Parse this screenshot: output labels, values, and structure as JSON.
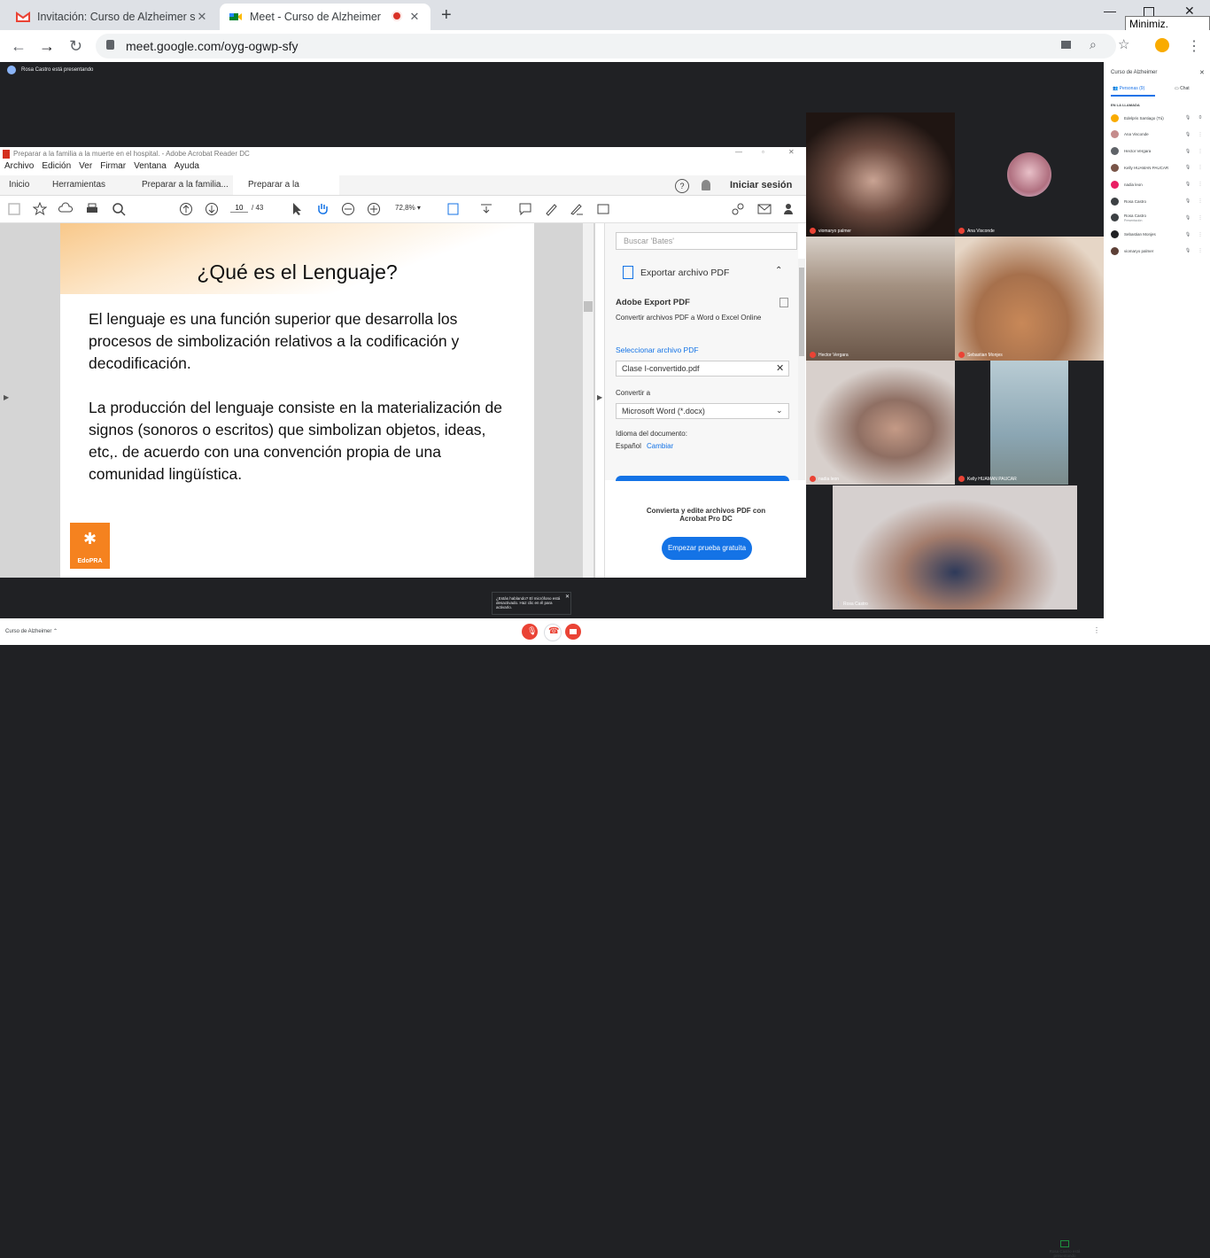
{
  "browser": {
    "tabs": [
      {
        "title": "Invitación: Curso de Alzheimer sá",
        "active": false,
        "icon": "gmail-icon"
      },
      {
        "title": "Meet - Curso de Alzheimer",
        "active": true,
        "icon": "meet-icon"
      }
    ],
    "tooltip": "Minimiz. tamaño",
    "url": "meet.google.com/oyg-ogwp-sfy"
  },
  "meet": {
    "presenting_text": "Rosa Castro está presentando",
    "meeting_name": "Curso de Alzheimer",
    "toast": "¿Estás hablando? El micrófono está desactivado. Haz clic en él para activarlo.",
    "presenter_status": "Rosa Castro está presentando"
  },
  "acrobat": {
    "title": "Preparar a la familia a la muerte en el hospital. - Adobe Acrobat Reader DC",
    "menu": [
      "Archivo",
      "Edición",
      "Ver",
      "Firmar",
      "Ventana",
      "Ayuda"
    ],
    "tabs": [
      "Inicio",
      "Herramientas",
      "Preparar a la familia...",
      "Preparar a la familia..."
    ],
    "signin": "Iniciar sesión",
    "page_current": "10",
    "page_total": "/ 43",
    "zoom": "72,8%",
    "slide": {
      "heading": "¿Qué es el Lenguaje?",
      "p1": "El lenguaje es una función superior que desarrolla los procesos de simbolización relativos a la codificación y decodificación.",
      "p2": "La producción del lenguaje consiste en la materialización de signos (sonoros o escritos) que simbolizan objetos, ideas, etc,. de acuerdo con una convención propia de una comunidad lingüística.",
      "logo_text": "EdoPRA"
    },
    "panel": {
      "search_placeholder": "Buscar 'Bates'",
      "export_title": "Exportar archivo PDF",
      "service_title": "Adobe Export PDF",
      "service_desc": "Convertir archivos PDF a Word o Excel Online",
      "select_label": "Seleccionar archivo PDF",
      "file": "Clase I-convertido.pdf",
      "convert_label": "Convertir a",
      "format": "Microsoft Word (*.docx)",
      "lang_label": "Idioma del documento:",
      "lang": "Español",
      "change": "Cambiar",
      "promo": "Convierta y edite archivos PDF con Acrobat Pro DC",
      "trial": "Empezar prueba gratuita"
    }
  },
  "tiles": [
    {
      "name": "viomaryo palmer",
      "color": "#3a2a25"
    },
    {
      "name": "Ana Visconde",
      "color": "#202124"
    },
    {
      "name": "Hector Vergara",
      "color": "#8d7a6a"
    },
    {
      "name": "Sebastian Monjes",
      "color": "#b57a55"
    },
    {
      "name": "nadia leon",
      "color": "#a8978a"
    },
    {
      "name": "Kelly HUAMAN PAUCAR",
      "color": "#8ba6b3"
    },
    {
      "name": "Rosa Castro",
      "color": "#c9c3c2"
    }
  ],
  "people_panel": {
    "title": "Curso de Alzheimer",
    "tab_people": "Personas (9)",
    "tab_chat": "Chat",
    "section": "EN LA LLAMADA",
    "self_count": "0",
    "participants": [
      {
        "name": "Edelpris Santiago (Tú)",
        "color": "#f9ab00",
        "sub": ""
      },
      {
        "name": "Ana Visconde",
        "color": "#c58b8b",
        "sub": ""
      },
      {
        "name": "Hector Vergara",
        "color": "#5f6368",
        "sub": ""
      },
      {
        "name": "Kelly HUAMAN PAUCAR",
        "color": "#795548",
        "sub": ""
      },
      {
        "name": "nadia leon",
        "color": "#e91e63",
        "sub": ""
      },
      {
        "name": "Rosa Castro",
        "color": "#3c4043",
        "sub": ""
      },
      {
        "name": "Rosa Castro",
        "color": "#3c4043",
        "sub": "Presentación"
      },
      {
        "name": "Sebastian Monjes",
        "color": "#202124",
        "sub": ""
      },
      {
        "name": "viomaryo palmer",
        "color": "#5d4037",
        "sub": ""
      }
    ]
  }
}
